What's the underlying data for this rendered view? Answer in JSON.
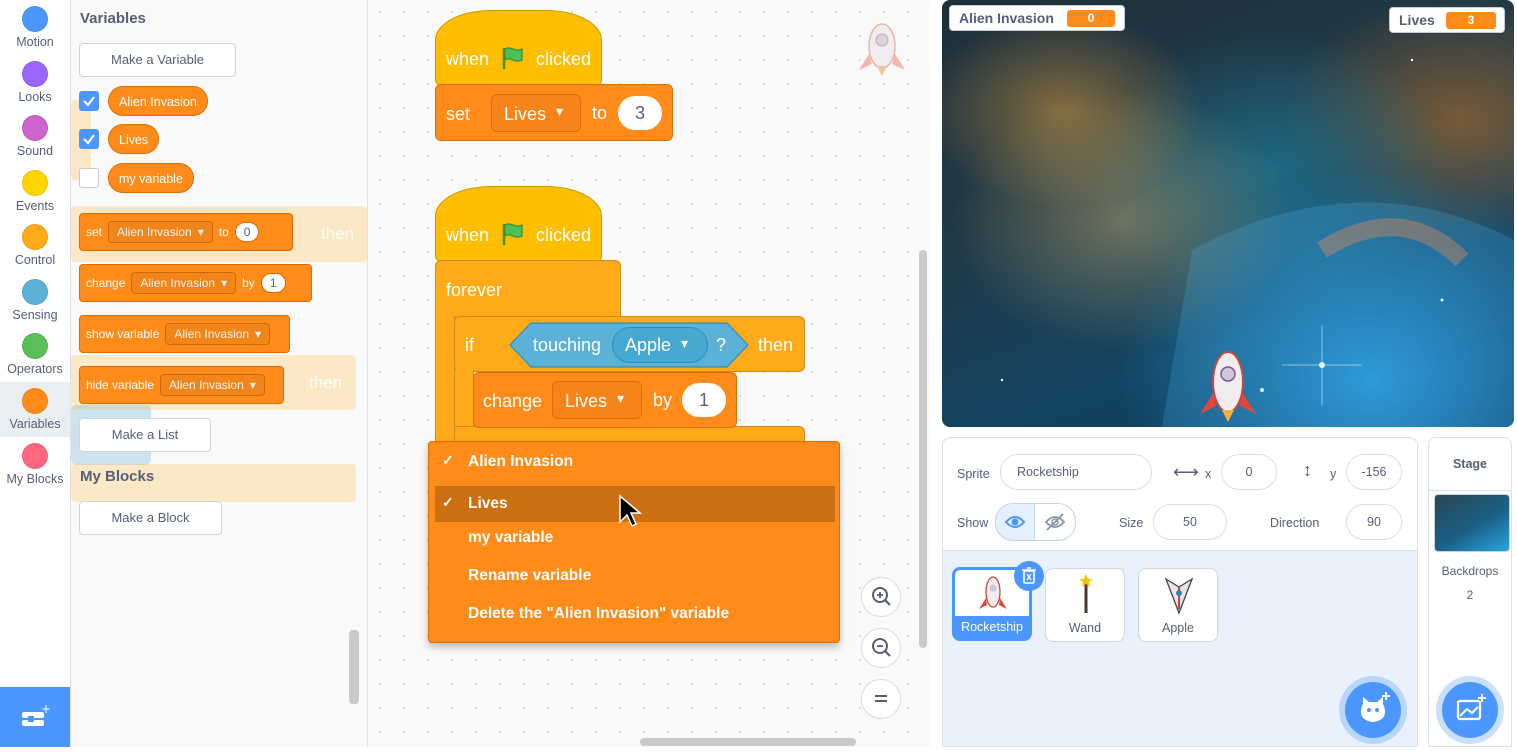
{
  "categories": [
    {
      "label": "Motion",
      "color": "#4c97ff"
    },
    {
      "label": "Looks",
      "color": "#9966ff"
    },
    {
      "label": "Sound",
      "color": "#cf63cf"
    },
    {
      "label": "Events",
      "color": "#ffd500"
    },
    {
      "label": "Control",
      "color": "#ffab19"
    },
    {
      "label": "Sensing",
      "color": "#5cb1d6"
    },
    {
      "label": "Operators",
      "color": "#59c059"
    },
    {
      "label": "Variables",
      "color": "#ff8c1a"
    },
    {
      "label": "My Blocks",
      "color": "#ff6680"
    }
  ],
  "palette": {
    "variables_heading": "Variables",
    "make_variable": "Make a Variable",
    "variables": [
      {
        "name": "Alien Invasion",
        "checked": true
      },
      {
        "name": "Lives",
        "checked": true
      },
      {
        "name": "my variable",
        "checked": false
      }
    ],
    "set_block": {
      "word": "set",
      "var": "Alien Invasion",
      "to": "to",
      "value": "0"
    },
    "change_block": {
      "word": "change",
      "var": "Alien Invasion",
      "by": "by",
      "value": "1"
    },
    "show_block": {
      "word": "show variable",
      "var": "Alien Invasion"
    },
    "hide_block": {
      "word": "hide variable",
      "var": "Alien Invasion"
    },
    "make_list": "Make a List",
    "myblocks_heading": "My Blocks",
    "make_block": "Make a Block",
    "ghost_then_1": "then",
    "ghost_then_2": "then"
  },
  "script1": {
    "when": "when",
    "clicked": "clicked",
    "set": "set",
    "var": "Lives",
    "to": "to",
    "value": "3"
  },
  "script2": {
    "when": "when",
    "clicked": "clicked",
    "forever": "forever",
    "if": "if",
    "touching": "touching",
    "touch_target": "Apple",
    "q": "?",
    "then": "then",
    "change": "change",
    "var": "Lives",
    "by": "by",
    "value": "1"
  },
  "dropdown": {
    "items": [
      {
        "label": "Alien Invasion",
        "checked": true
      },
      {
        "label": "Lives",
        "checked": true,
        "hover": true
      },
      {
        "label": "my variable",
        "checked": false
      },
      {
        "label": "Rename variable",
        "checked": false
      },
      {
        "label": "Delete the \"Alien Invasion\" variable",
        "checked": false
      }
    ],
    "check_glyph": "✓"
  },
  "stage": {
    "monitor_alien": {
      "label": "Alien Invasion",
      "value": "0"
    },
    "monitor_lives": {
      "label": "Lives",
      "value": "3"
    }
  },
  "sprite_info": {
    "sprite_label": "Sprite",
    "sprite_name": "Rocketship",
    "x_label": "x",
    "x_value": "0",
    "y_label": "y",
    "y_value": "-156",
    "show_label": "Show",
    "size_label": "Size",
    "size_value": "50",
    "direction_label": "Direction",
    "direction_value": "90"
  },
  "sprites": [
    {
      "name": "Rocketship",
      "selected": true
    },
    {
      "name": "Wand",
      "selected": false
    },
    {
      "name": "Apple",
      "selected": false
    }
  ],
  "stage_pane": {
    "title": "Stage",
    "backdrops_label": "Backdrops",
    "backdrops_count": "2"
  },
  "colors": {
    "variables": "#ff8c1a",
    "events": "#ffbf00",
    "control": "#ffab19",
    "sensing": "#5cb1d6",
    "accent": "#4c97ff"
  }
}
